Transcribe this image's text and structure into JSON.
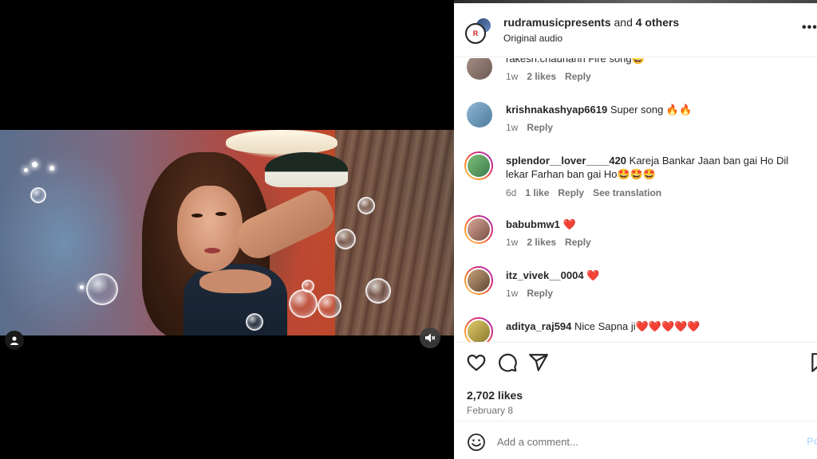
{
  "header": {
    "author": "rudramusicpresents",
    "joiner": " and ",
    "others": "4 others",
    "audio_label": "Original audio",
    "avatar_mark": "R",
    "more": "•••"
  },
  "comments": [
    {
      "user": "rakesh.chauhanh",
      "text": " Fire song😄",
      "time": "1w",
      "likes": "2 likes",
      "reply": "Reply"
    },
    {
      "user": "krishnakashyap6619",
      "text": " Super song 🔥🔥",
      "time": "1w",
      "reply": "Reply"
    },
    {
      "user": "splendor__lover____420",
      "text": " Kareja Bankar Jaan ban gai Ho Dil lekar Farhan ban gai Ho🤩🤩🤩",
      "time": "6d",
      "likes": "1 like",
      "reply": "Reply",
      "translate": "See translation"
    },
    {
      "user": "babubmw1",
      "text": " ❤️",
      "time": "1w",
      "likes": "2 likes",
      "reply": "Reply"
    },
    {
      "user": "itz_vivek__0004",
      "text": " ❤️",
      "time": "1w",
      "reply": "Reply"
    },
    {
      "user": "aditya_raj594",
      "text": " Nice Sapna ji❤️❤️❤️❤️❤️"
    }
  ],
  "actions": {
    "icons": [
      "heart-icon",
      "comment-icon",
      "share-icon",
      "bookmark-icon"
    ]
  },
  "likes": "2,702 likes",
  "date": "February 8",
  "comment_box": {
    "placeholder": "Add a comment...",
    "post_label": "Post"
  },
  "colors": {
    "text": "#262626",
    "muted": "#737373",
    "post_disabled": "#c0dffd",
    "heart_red": "#ed4956"
  }
}
